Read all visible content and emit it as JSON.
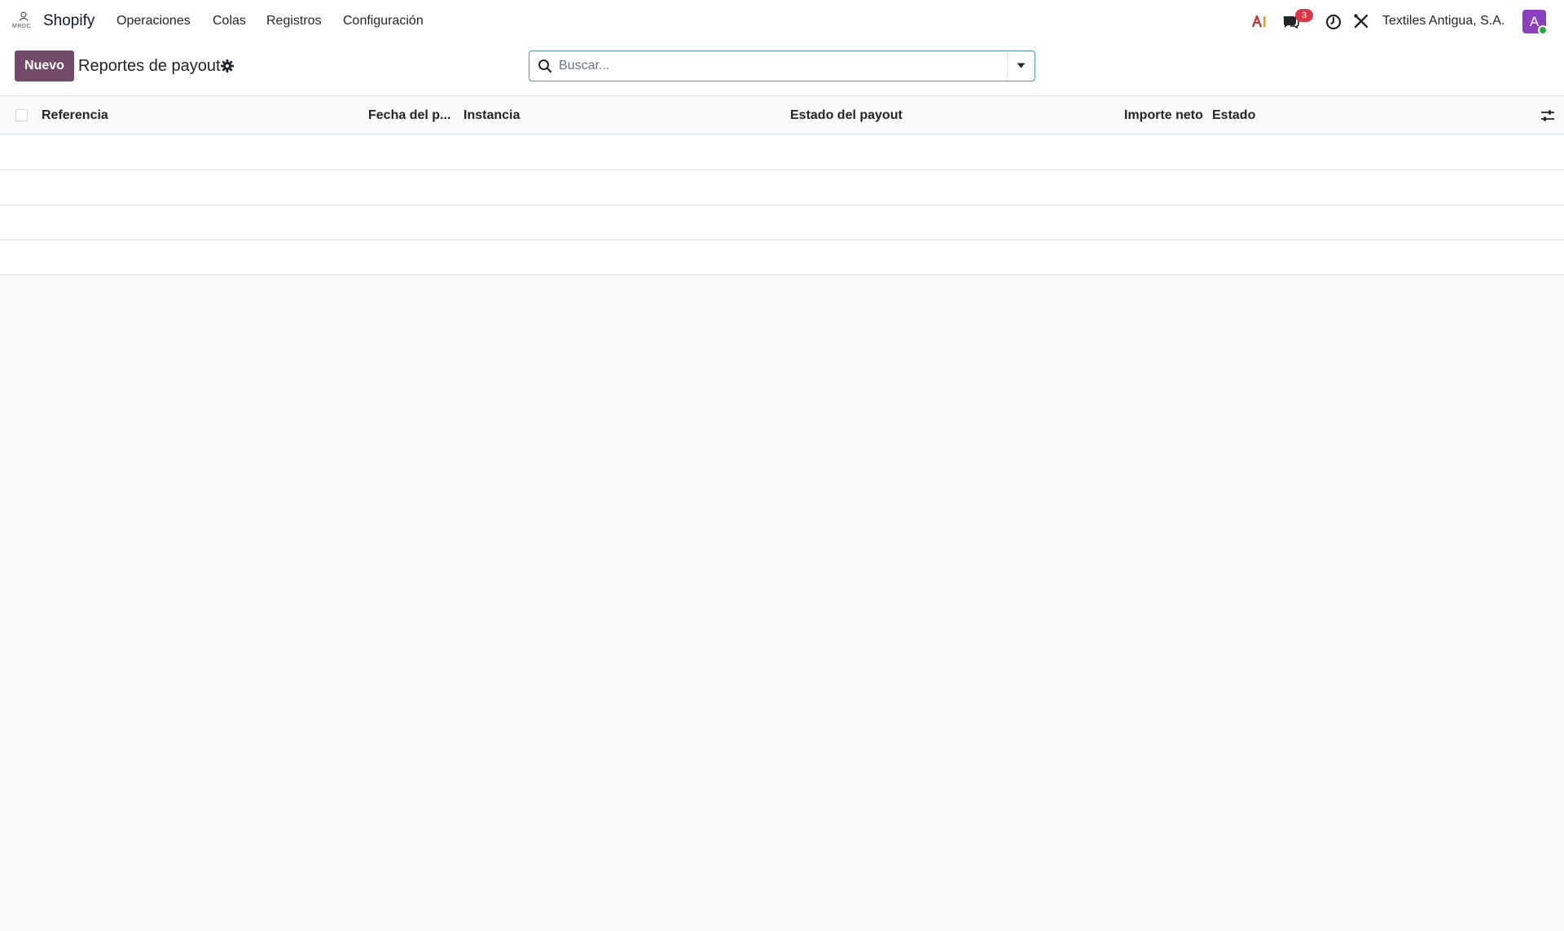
{
  "navbar": {
    "app_name": "Shopify",
    "menu": [
      {
        "label": "Operaciones"
      },
      {
        "label": "Colas"
      },
      {
        "label": "Registros"
      },
      {
        "label": "Configuración"
      }
    ],
    "chat_badge_count": "3",
    "company": "Textiles Antigua, S.A.",
    "avatar_letter": "A"
  },
  "control_panel": {
    "new_button_label": "Nuevo",
    "title": "Reportes de payout",
    "search_placeholder": "Buscar..."
  },
  "list": {
    "columns": [
      {
        "label": "Referencia"
      },
      {
        "label": "Fecha del p..."
      },
      {
        "label": "Instancia"
      },
      {
        "label": "Estado del payout"
      },
      {
        "label": "Importe neto"
      },
      {
        "label": "Estado"
      }
    ],
    "rows": [
      {},
      {},
      {},
      {}
    ]
  },
  "colors": {
    "brand_primary": "#714b67",
    "search_border": "#4a9ba5",
    "badge": "#dc3545",
    "avatar": "#8b3fbf",
    "presence": "#28a745"
  },
  "icons": {
    "app_logo": "shopify-connector-logo",
    "ai": "ai-icon",
    "chat": "chat-icon",
    "activity": "clock-icon",
    "debug": "tools-icon",
    "settings": "gear-icon",
    "search": "search-icon",
    "dropdown": "caret-down-icon",
    "columns": "sliders-icon"
  }
}
